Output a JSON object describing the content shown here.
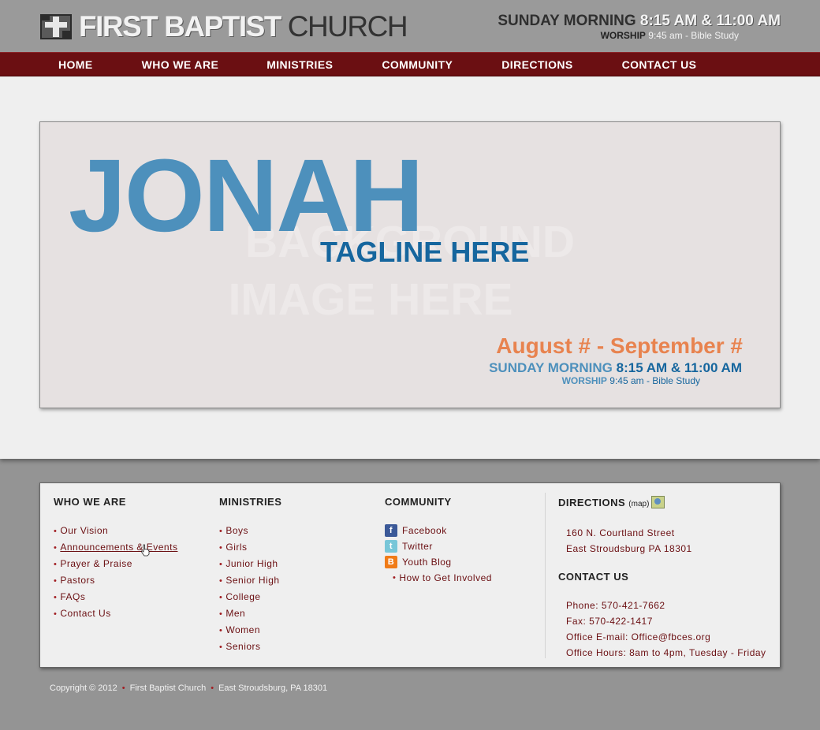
{
  "header": {
    "logo_bold": "FIRST BAPTIST",
    "logo_light": " CHURCH",
    "service_label": "SUNDAY MORNING",
    "service_times": "8:15 AM & 11:00 AM",
    "worship_label": "WORSHIP",
    "worship_detail": "9:45 am - Bible Study"
  },
  "nav": {
    "items": [
      "HOME",
      "WHO WE ARE",
      "MINISTRIES",
      "COMMUNITY",
      "DIRECTIONS",
      "CONTACT US"
    ]
  },
  "banner": {
    "bg_line1": "BACKGROUND",
    "bg_line2": "IMAGE HERE",
    "title": "JONAH",
    "tagline": "TAGLINE HERE",
    "dates": "August # - September #",
    "service_label": "SUNDAY MORNING",
    "service_times": "8:15 AM & 11:00 AM",
    "worship_label": "WORSHIP",
    "worship_detail": "9:45 am - Bible Study"
  },
  "footer": {
    "who": {
      "title": "WHO WE ARE",
      "items": [
        "Our Vision",
        "Announcements & Events",
        "Prayer & Praise",
        "Pastors",
        "FAQs",
        "Contact Us"
      ]
    },
    "ministries": {
      "title": "MINISTRIES",
      "items": [
        "Boys",
        "Girls",
        "Junior High",
        "Senior High",
        "College",
        "Men",
        "Women",
        "Seniors"
      ]
    },
    "community": {
      "title": "COMMUNITY",
      "facebook": "Facebook",
      "twitter": "Twitter",
      "blog": "Youth Blog",
      "involved": "How to Get Involved"
    },
    "directions": {
      "title": "DIRECTIONS",
      "map_label": "(map)",
      "street": "160 N. Courtland Street",
      "city": "East Stroudsburg PA 18301"
    },
    "contact": {
      "title": "CONTACT US",
      "phone": "Phone: 570-421-7662",
      "fax": "Fax: 570-422-1417",
      "email": "Office E-mail: Office@fbces.org",
      "hours": "Office Hours: 8am to 4pm, Tuesday - Friday"
    }
  },
  "copyright": {
    "notice": "Copyright © 2012",
    "church": "First Baptist Church",
    "location": "East Stroudsburg, PA 18301"
  },
  "colors": {
    "nav_bg": "#6b0f12",
    "accent_blue": "#4d90bc",
    "dark_blue": "#16669e",
    "orange": "#e8834f",
    "link_red": "#6b0f12"
  }
}
